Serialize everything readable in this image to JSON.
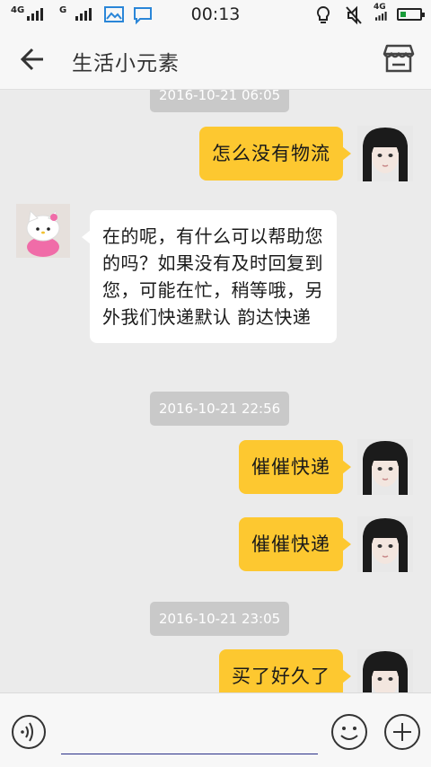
{
  "status_bar": {
    "network_1": "4G",
    "network_2": "G",
    "network_3": "4G",
    "time": "00:13",
    "battery_color": "#1a9c3a",
    "icons": [
      "signal-icon",
      "image-icon",
      "chat-icon",
      "bulb-icon",
      "mute-icon",
      "battery-icon"
    ]
  },
  "header": {
    "title": "生活小元素",
    "back_icon": "back-arrow-icon",
    "shop_icon": "shop-icon"
  },
  "messages": [
    {
      "type": "timestamp",
      "text": "2016-10-21 06:05"
    },
    {
      "type": "outgoing",
      "text": "怎么没有物流"
    },
    {
      "type": "incoming",
      "text": "在的呢，有什么可以帮助您的吗？如果没有及时回复到您，可能在忙，稍等哦，另外我们快递默认 韵达快递"
    },
    {
      "type": "timestamp",
      "text": "2016-10-21 22:56"
    },
    {
      "type": "outgoing",
      "text": "催催快递"
    },
    {
      "type": "outgoing",
      "text": "催催快递"
    },
    {
      "type": "timestamp",
      "text": "2016-10-21 23:05"
    },
    {
      "type": "outgoing",
      "text": "买了好久了"
    }
  ],
  "input_bar": {
    "voice_icon": "voice-icon",
    "input_value": "",
    "emoji_icon": "emoji-icon",
    "plus_icon": "plus-icon"
  },
  "colors": {
    "outgoing_bubble": "#fdc830",
    "incoming_bubble": "#ffffff",
    "timestamp_bg": "#c9c9c9",
    "chat_bg": "#ebebeb",
    "input_underline": "#2a2f88"
  }
}
